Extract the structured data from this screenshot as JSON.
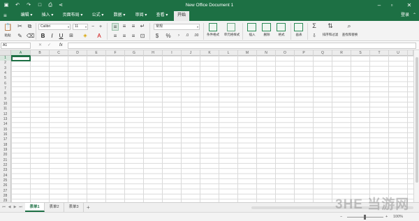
{
  "window": {
    "title": "New Office Document 1"
  },
  "quick_access": [
    {
      "name": "save-icon",
      "glyph": "▣"
    },
    {
      "name": "undo-icon",
      "glyph": "↶"
    },
    {
      "name": "redo-icon",
      "glyph": "↷"
    },
    {
      "name": "new-document-icon",
      "glyph": "□"
    },
    {
      "name": "print-icon",
      "glyph": "⎙"
    },
    {
      "name": "share-icon",
      "glyph": "⋖"
    }
  ],
  "menu": {
    "tabs": [
      "编辑",
      "插入",
      "页面布局",
      "公式",
      "数据",
      "审阅",
      "查看",
      "开始"
    ],
    "active_tab": "开始",
    "login": "登录"
  },
  "ribbon": {
    "paste_label": "粘贴",
    "font_name": "Calibri",
    "font_size": "11",
    "number_format": "常规",
    "conditional_format": "条件格式",
    "cell_style": "单元格样式",
    "insert": "插入",
    "delete": "删除",
    "format": "格式",
    "chart": "画表",
    "sort_filter": "排序和过滤",
    "find_replace": "查找和替换"
  },
  "formula_bar": {
    "cell_ref": "A1",
    "fx": "fx",
    "value": ""
  },
  "columns": [
    "A",
    "B",
    "C",
    "D",
    "E",
    "F",
    "G",
    "H",
    "I",
    "J",
    "K",
    "L",
    "M",
    "N",
    "O",
    "P",
    "Q",
    "R",
    "S",
    "T",
    "U"
  ],
  "rows": [
    "1",
    "2",
    "3",
    "4",
    "5",
    "6",
    "7",
    "8",
    "9",
    "10",
    "11",
    "12",
    "13",
    "14",
    "15",
    "16",
    "17",
    "18",
    "19",
    "20",
    "21",
    "22",
    "23",
    "24",
    "25",
    "26",
    "27",
    "28",
    "29"
  ],
  "selected": {
    "column": "A",
    "row": "1"
  },
  "sheets": [
    "表单1",
    "表单2",
    "表单3"
  ],
  "active_sheet": "表单1",
  "add_sheet": "+",
  "status": {
    "zoom": "100%"
  },
  "watermark": "3HE 当游网",
  "colors": {
    "accent": "#1d7044",
    "ribbon_bg": "#f3f3f3",
    "grid_line": "#dadada"
  }
}
